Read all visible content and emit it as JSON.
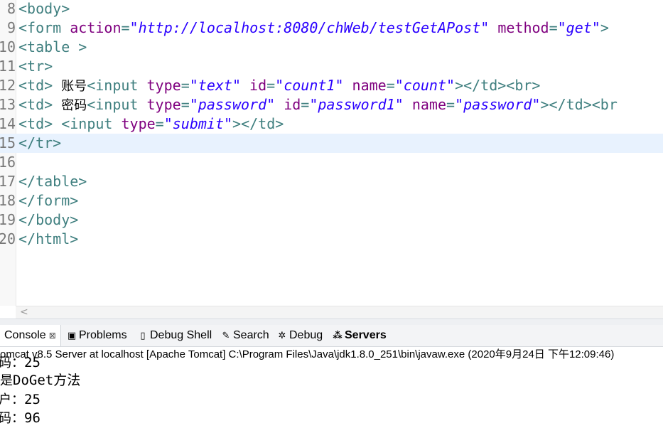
{
  "editor": {
    "lines": [
      {
        "num": "8",
        "segs": [
          {
            "c": "tag",
            "t": "<body>"
          }
        ]
      },
      {
        "num": "9",
        "segs": [
          {
            "c": "tag",
            "t": "<form "
          },
          {
            "c": "attr",
            "t": "action"
          },
          {
            "c": "tag",
            "t": "="
          },
          {
            "c": "val",
            "t": "\"http://localhost:8080/chWeb/testGetAPost\""
          },
          {
            "c": "tag",
            "t": " "
          },
          {
            "c": "attr",
            "t": "method"
          },
          {
            "c": "tag",
            "t": "="
          },
          {
            "c": "val",
            "t": "\"get\""
          },
          {
            "c": "tag",
            "t": ">"
          }
        ]
      },
      {
        "num": "10",
        "segs": [
          {
            "c": "tag",
            "t": "<table >"
          }
        ]
      },
      {
        "num": "11",
        "segs": [
          {
            "c": "tag",
            "t": "<tr>"
          }
        ]
      },
      {
        "num": "12",
        "segs": [
          {
            "c": "tag",
            "t": "<td> "
          },
          {
            "c": "txt",
            "t": "账号"
          },
          {
            "c": "tag",
            "t": "<input "
          },
          {
            "c": "attr",
            "t": "type"
          },
          {
            "c": "tag",
            "t": "="
          },
          {
            "c": "val",
            "t": "\"text\""
          },
          {
            "c": "tag",
            "t": " "
          },
          {
            "c": "attr",
            "t": "id"
          },
          {
            "c": "tag",
            "t": "="
          },
          {
            "c": "val",
            "t": "\"count1\""
          },
          {
            "c": "tag",
            "t": " "
          },
          {
            "c": "attr",
            "t": "name"
          },
          {
            "c": "tag",
            "t": "="
          },
          {
            "c": "val",
            "t": "\"count\""
          },
          {
            "c": "tag",
            "t": "></td><br>"
          }
        ]
      },
      {
        "num": "13",
        "segs": [
          {
            "c": "tag",
            "t": "<td> "
          },
          {
            "c": "txt",
            "t": "密码"
          },
          {
            "c": "tag",
            "t": "<input "
          },
          {
            "c": "attr",
            "t": "type"
          },
          {
            "c": "tag",
            "t": "="
          },
          {
            "c": "val",
            "t": "\"password\""
          },
          {
            "c": "tag",
            "t": " "
          },
          {
            "c": "attr",
            "t": "id"
          },
          {
            "c": "tag",
            "t": "="
          },
          {
            "c": "val",
            "t": "\"password1\""
          },
          {
            "c": "tag",
            "t": " "
          },
          {
            "c": "attr",
            "t": "name"
          },
          {
            "c": "tag",
            "t": "="
          },
          {
            "c": "val",
            "t": "\"password\""
          },
          {
            "c": "tag",
            "t": "></td><br"
          }
        ]
      },
      {
        "num": "14",
        "segs": [
          {
            "c": "tag",
            "t": "<td> <input "
          },
          {
            "c": "attr",
            "t": "type"
          },
          {
            "c": "tag",
            "t": "="
          },
          {
            "c": "val",
            "t": "\"submit\""
          },
          {
            "c": "tag",
            "t": "></td>"
          }
        ]
      },
      {
        "num": "15",
        "current": true,
        "segs": [
          {
            "c": "tag",
            "t": "</tr>"
          }
        ]
      },
      {
        "num": "16",
        "segs": []
      },
      {
        "num": "17",
        "segs": [
          {
            "c": "tag",
            "t": "</table>"
          }
        ]
      },
      {
        "num": "18",
        "segs": [
          {
            "c": "tag",
            "t": "</form>"
          }
        ]
      },
      {
        "num": "19",
        "segs": [
          {
            "c": "tag",
            "t": "</body>"
          }
        ]
      },
      {
        "num": "20",
        "segs": [
          {
            "c": "tag",
            "t": "</html>"
          }
        ]
      }
    ]
  },
  "scrollbar": {
    "left_arrow": "<"
  },
  "tabs": [
    {
      "label": "Console",
      "icon": "console-icon",
      "glyph": "",
      "active": true,
      "close": "⊠"
    },
    {
      "label": "Problems",
      "icon": "problems-icon",
      "glyph": "▣"
    },
    {
      "label": "Debug Shell",
      "icon": "debug-shell-icon",
      "glyph": "▯"
    },
    {
      "label": "Search",
      "icon": "search-icon",
      "glyph": "✎"
    },
    {
      "label": "Debug",
      "icon": "debug-icon",
      "glyph": "✲"
    },
    {
      "label": "Servers",
      "icon": "servers-icon",
      "glyph": "⁂",
      "bold": true
    }
  ],
  "console": {
    "header": "omcat v8.5 Server at localhost [Apache Tomcat] C:\\Program Files\\Java\\jdk1.8.0_251\\bin\\javaw.exe (2020年9月24日 下午12:09:46)",
    "lines": [
      {
        "label": "码：",
        "value": "25"
      },
      {
        "label": "是",
        "value": "DoGet方法"
      },
      {
        "label": "户：",
        "value": "25"
      },
      {
        "label": "码：",
        "value": "96"
      }
    ]
  }
}
